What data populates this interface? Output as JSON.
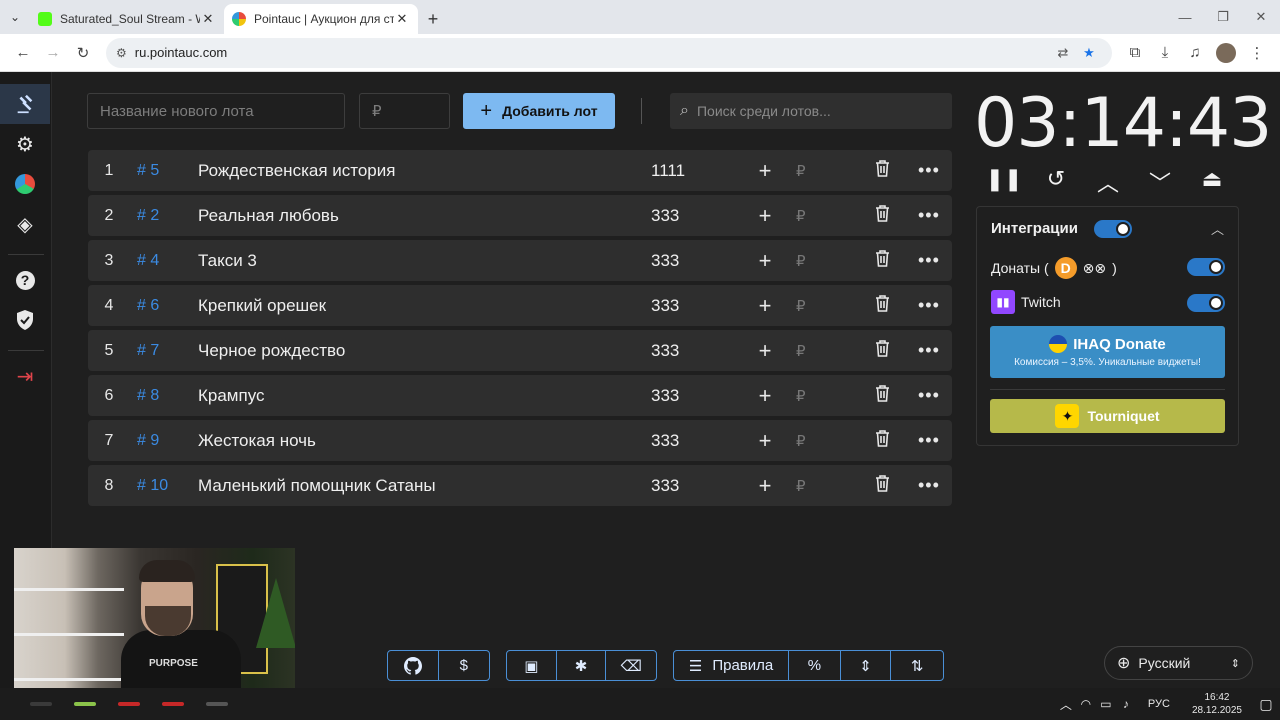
{
  "browser": {
    "tabs": [
      {
        "title": "Saturated_Soul Stream - Watch",
        "favicon_color": "#53fc18",
        "active": false
      },
      {
        "title": "Pointauc | Аукцион для стриме",
        "favicon_color": "#e84c3d",
        "active": true
      }
    ],
    "url": "ru.pointauc.com"
  },
  "app": {
    "new_lot_placeholder": "Название нового лота",
    "amount_placeholder": "₽",
    "add_button_label": "Добавить лот",
    "search_placeholder": "Поиск среди лотов...",
    "currency_symbol": "₽",
    "lots": [
      {
        "index": "1",
        "fast_id": "# 5",
        "name": "Рождественская история",
        "amount": "1111"
      },
      {
        "index": "2",
        "fast_id": "# 2",
        "name": "Реальная любовь",
        "amount": "333"
      },
      {
        "index": "3",
        "fast_id": "# 4",
        "name": "Такси 3",
        "amount": "333"
      },
      {
        "index": "4",
        "fast_id": "# 6",
        "name": "Крепкий орешек",
        "amount": "333"
      },
      {
        "index": "5",
        "fast_id": "# 7",
        "name": "Черное рождество",
        "amount": "333"
      },
      {
        "index": "6",
        "fast_id": "# 8",
        "name": "Крампус",
        "amount": "333"
      },
      {
        "index": "7",
        "fast_id": "# 9",
        "name": "Жестокая ночь",
        "amount": "333"
      },
      {
        "index": "8",
        "fast_id": "# 10",
        "name": "Маленький помощник Сатаны",
        "amount": "333"
      }
    ],
    "timer": "03:14:43",
    "integrations": {
      "title": "Интеграции",
      "donations_label": "Донаты (",
      "donations_label_end": ")",
      "twitch_label": "Twitch",
      "ihaq_title": "IHAQ Donate",
      "ihaq_subtitle": "Комиссия – 3,5%. Уникальные виджеты!",
      "tourniquet_label": "Tourniquet"
    },
    "bottom": {
      "rules_label": "Правила",
      "dollar_label": "$",
      "percent_label": "%"
    },
    "language": "Русский"
  },
  "taskbar": {
    "lang": "РУС",
    "time": "16:42",
    "date": "28.12.2025"
  },
  "webcam": {
    "shirt_text": "PURPOSE"
  },
  "colors": {
    "accent": "#7db9f1",
    "id_blue": "#3b8be3",
    "toggle": "#2a78c8",
    "ihaq": "#3a8ec6",
    "tourniquet": "#b6b94a"
  }
}
